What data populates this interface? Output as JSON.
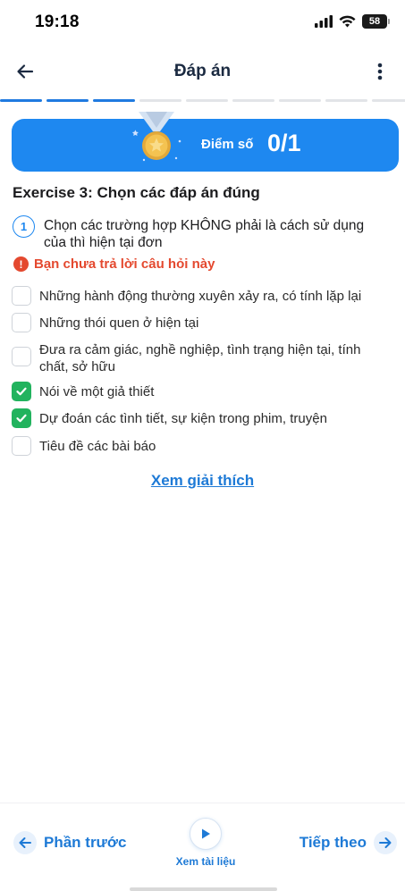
{
  "status_bar": {
    "time": "19:18",
    "battery": "58",
    "icons": [
      "signal-icon",
      "wifi-icon",
      "battery-icon"
    ]
  },
  "header": {
    "title": "Đáp án",
    "back_icon": "arrow-left-icon",
    "more_icon": "more-vertical-icon"
  },
  "progress": {
    "total_segments": 9,
    "completed_segments": 3,
    "accent_color": "#1f7ae0"
  },
  "score": {
    "label": "Điểm số",
    "value": "0/1",
    "icon": "medal-icon",
    "background_color": "#1e88f0"
  },
  "exercise": {
    "title": "Exercise 3: Chọn các đáp án đúng",
    "question_number": "1",
    "question_text": "Chọn các trường hợp KHÔNG phải là cách sử dụng của thì hiện tại đơn",
    "warning": "Bạn chưa trả lời câu hỏi này",
    "options": [
      {
        "text": "Những hành động thường xuyên xảy ra, có tính lặp lại",
        "checked": false
      },
      {
        "text": "Những thói quen ở hiện tại",
        "checked": false
      },
      {
        "text": "Đưa ra cảm giác, nghề nghiệp, tình trạng hiện tại, tính chất, sở hữu",
        "checked": false
      },
      {
        "text": "Nói về một giả thiết",
        "checked": true
      },
      {
        "text": "Dự đoán các tình tiết, sự kiện trong phim, truyện",
        "checked": true
      },
      {
        "text": "Tiêu đề các bài báo",
        "checked": false
      }
    ]
  },
  "explain_link": "Xem giải thích",
  "bottom_nav": {
    "prev_label": "Phần trước",
    "docs_label": "Xem tài liệu",
    "next_label": "Tiếp theo"
  },
  "colors": {
    "primary": "#1e88f0",
    "link": "#1e7ad6",
    "warning": "#e4492f",
    "checked": "#22b35e"
  }
}
